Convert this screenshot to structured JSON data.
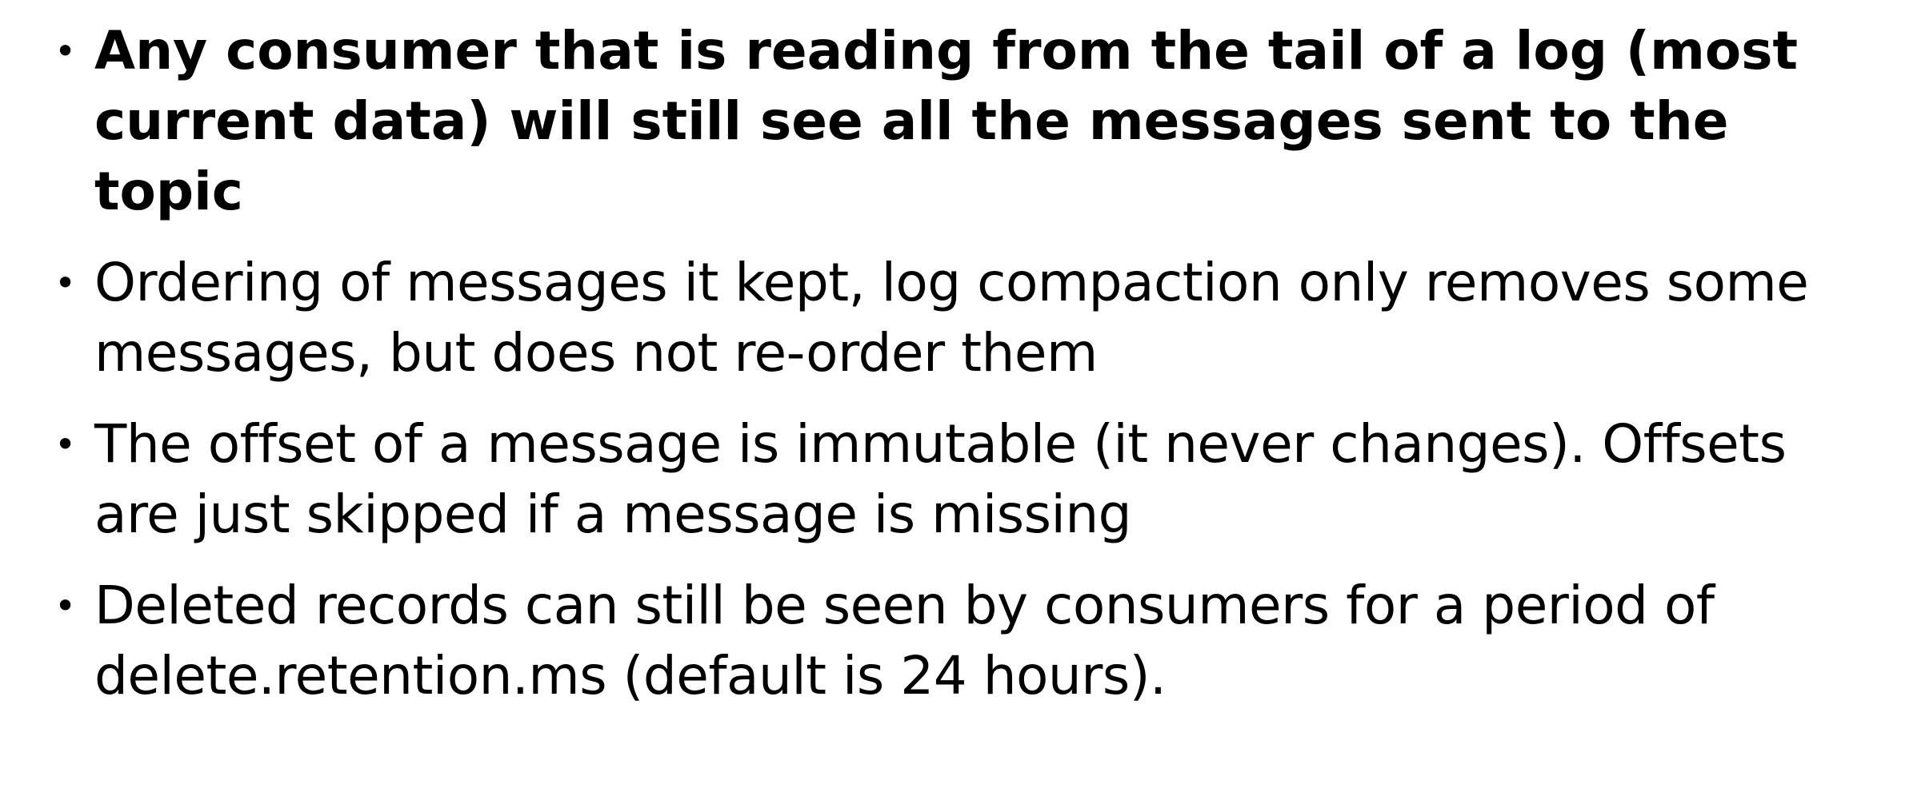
{
  "slide": {
    "bullet_symbol": "•",
    "bullets": [
      {
        "text": "Any consumer that is reading from the tail of a log (most current data) will still see all the messages sent to the topic",
        "emphasis": "bold"
      },
      {
        "text": "Ordering of messages it kept, log compaction only removes some messages, but does not re-order them",
        "emphasis": "normal"
      },
      {
        "text": "The offset of a message is immutable (it never changes). Offsets are just skipped if a message is missing",
        "emphasis": "normal"
      },
      {
        "text": "Deleted records can still be seen by consumers for a period of delete.retention.ms (default is 24 hours).",
        "emphasis": "normal"
      }
    ]
  }
}
